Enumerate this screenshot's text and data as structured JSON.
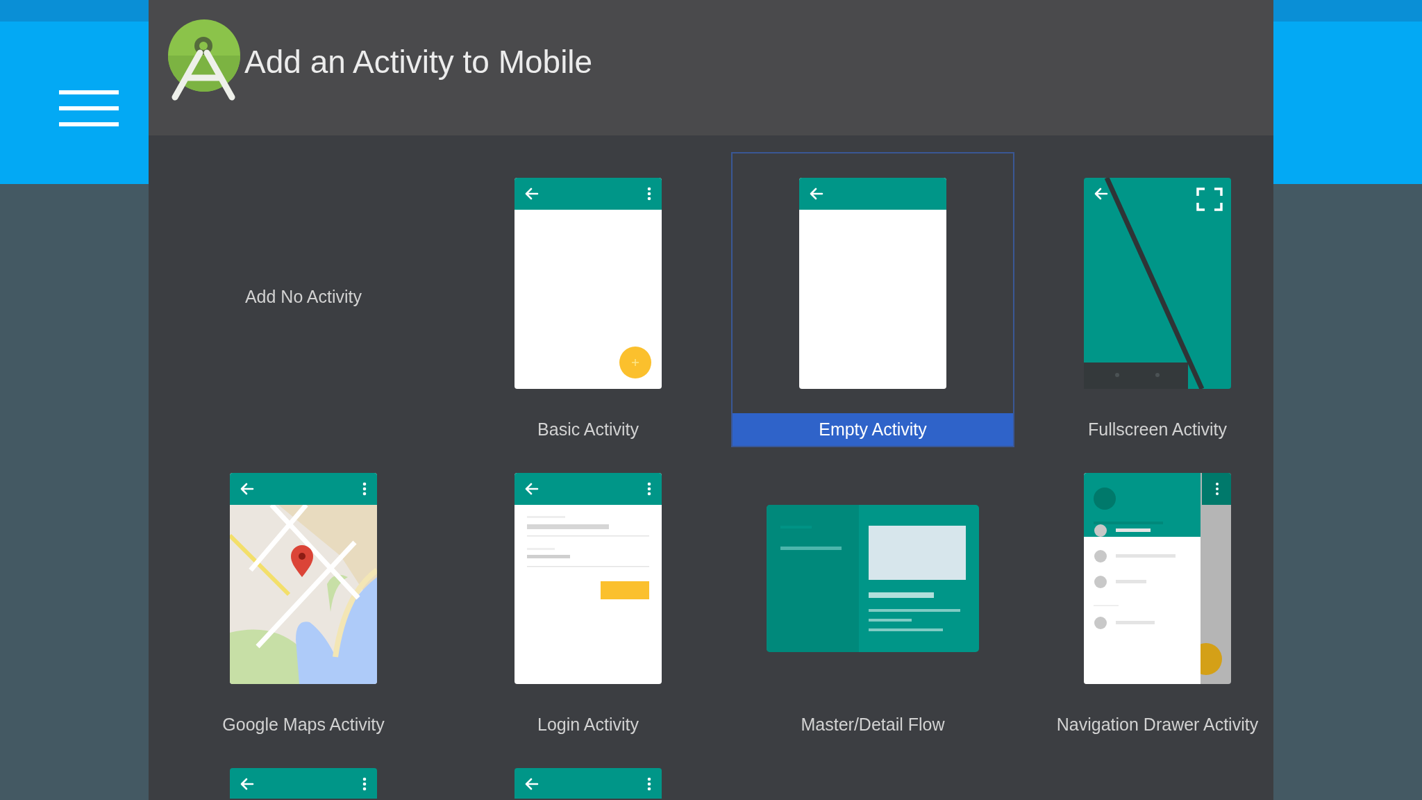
{
  "dialog": {
    "title": "Add an Activity to Mobile"
  },
  "activities": [
    {
      "kind": "none",
      "label": "Add No Activity",
      "selected": false
    },
    {
      "kind": "basic",
      "label": "Basic Activity",
      "selected": false
    },
    {
      "kind": "empty",
      "label": "Empty Activity",
      "selected": true
    },
    {
      "kind": "fullscreen",
      "label": "Fullscreen Activity",
      "selected": false
    },
    {
      "kind": "maps",
      "label": "Google Maps Activity",
      "selected": false
    },
    {
      "kind": "login",
      "label": "Login Activity",
      "selected": false
    },
    {
      "kind": "master_detail",
      "label": "Master/Detail Flow",
      "selected": false
    },
    {
      "kind": "nav_drawer",
      "label": "Navigation Drawer Activity",
      "selected": false
    },
    {
      "kind": "toolbar_only",
      "selected": false
    },
    {
      "kind": "toolbar_only",
      "selected": false
    }
  ]
}
